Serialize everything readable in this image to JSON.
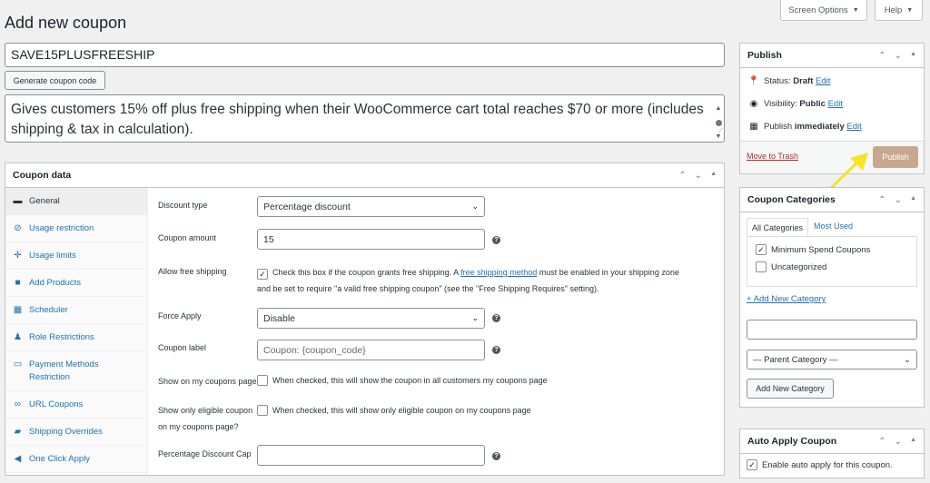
{
  "top_buttons": {
    "screen_options": "Screen Options",
    "help": "Help"
  },
  "page_title": "Add new coupon",
  "coupon_code": "SAVE15PLUSFREESHIP",
  "generate_button": "Generate coupon code",
  "description": "Gives customers 15% off plus free shipping when their WooCommerce cart total reaches $70 or more (includes shipping & tax in calculation).",
  "coupon_data": {
    "title": "Coupon data",
    "tabs": [
      {
        "label": "General",
        "icon": "ticket-icon"
      },
      {
        "label": "Usage restriction",
        "icon": "block-icon"
      },
      {
        "label": "Usage limits",
        "icon": "arrows-icon"
      },
      {
        "label": "Add Products",
        "icon": "bag-icon"
      },
      {
        "label": "Scheduler",
        "icon": "calendar-icon"
      },
      {
        "label": "Role Restrictions",
        "icon": "person-icon"
      },
      {
        "label": "Payment Methods Restriction",
        "icon": "card-icon"
      },
      {
        "label": "URL Coupons",
        "icon": "link-icon"
      },
      {
        "label": "Shipping Overrides",
        "icon": "truck-icon"
      },
      {
        "label": "One Click Apply",
        "icon": "megaphone-icon"
      }
    ],
    "fields": {
      "discount_type_label": "Discount type",
      "discount_type_value": "Percentage discount",
      "coupon_amount_label": "Coupon amount",
      "coupon_amount_value": "15",
      "free_shipping_label": "Allow free shipping",
      "free_shipping_text_1": "Check this box if the coupon grants free shipping. A",
      "free_shipping_link": "free shipping method",
      "free_shipping_text_2": "must be enabled in your shipping zone",
      "free_shipping_text_3": "and be set to require \"a valid free shipping coupon\" (see the \"Free Shipping Requires\" setting).",
      "force_apply_label": "Force Apply",
      "force_apply_value": "Disable",
      "coupon_label_label": "Coupon label",
      "coupon_label_placeholder": "Coupon: {coupon_code}",
      "show_my_coupons_label": "Show on my coupons page?",
      "show_my_coupons_text": "When checked, this will show the coupon in all customers my coupons page",
      "show_eligible_label_1": "Show only eligible coupon",
      "show_eligible_label_2": "on my coupons page?",
      "show_eligible_text": "When checked, this will show only eligible coupon on my coupons page",
      "percentage_cap_label": "Percentage Discount Cap"
    }
  },
  "publish": {
    "title": "Publish",
    "status_label": "Status:",
    "status_value": "Draft",
    "visibility_label": "Visibility:",
    "visibility_value": "Public",
    "publish_label": "Publish",
    "publish_value": "immediately",
    "edit": "Edit",
    "trash": "Move to Trash",
    "publish_button": "Publish"
  },
  "categories": {
    "title": "Coupon Categories",
    "tab_all": "All Categories",
    "tab_used": "Most Used",
    "items": [
      {
        "label": "Minimum Spend Coupons",
        "checked": true
      },
      {
        "label": "Uncategorized",
        "checked": false
      }
    ],
    "add_new_link": "+ Add New Category",
    "parent_select": "— Parent Category —",
    "add_button": "Add New Category"
  },
  "auto_apply": {
    "title": "Auto Apply Coupon",
    "checkbox_label": "Enable auto apply for this coupon."
  },
  "colors": {
    "accent": "#2271b1",
    "publish_button": "#c8a78e",
    "trash": "#b32d2e",
    "arrow": "#f5e524"
  }
}
